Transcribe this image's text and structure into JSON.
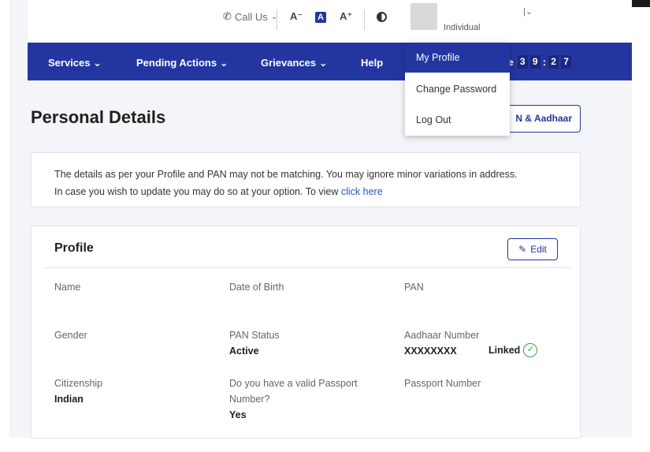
{
  "topbar": {
    "call_label": "Call Us",
    "font_decrease": "A⁻",
    "font_normal": "A",
    "font_increase": "A⁺",
    "user_type": "Individual"
  },
  "nav": {
    "items": [
      "Services",
      "Pending Actions",
      "Grievances",
      "Help"
    ],
    "timer_label": "e",
    "timer_digits": [
      "3",
      "9",
      "2",
      "7"
    ]
  },
  "dropdown": {
    "items": [
      "My Profile",
      "Change Password",
      "Log Out"
    ]
  },
  "page": {
    "title": "Personal Details",
    "pan_button_label": "N & Aadhaar"
  },
  "notice": {
    "line1": "The details as per your Profile and PAN may not be matching. You may ignore minor variations in address.",
    "line2": "In case you wish to update you may do so at your option. To view ",
    "link": "click here"
  },
  "profile": {
    "title": "Profile",
    "edit_label": "Edit",
    "name_label": "Name",
    "dob_label": "Date of Birth",
    "pan_label": "PAN",
    "gender_label": "Gender",
    "pan_status_label": "PAN Status",
    "pan_status_value": "Active",
    "aadhaar_label": "Aadhaar Number",
    "aadhaar_value": "XXXXXXXX",
    "linked_label": "Linked",
    "citizenship_label": "Citizenship",
    "citizenship_value": "Indian",
    "passport_q_label": "Do you have a valid Passport Number?",
    "passport_q_value": "Yes",
    "passport_number_label": "Passport Number"
  },
  "colors": {
    "brand": "#2336a0",
    "link": "#2554d4",
    "success": "#2ea34a"
  }
}
